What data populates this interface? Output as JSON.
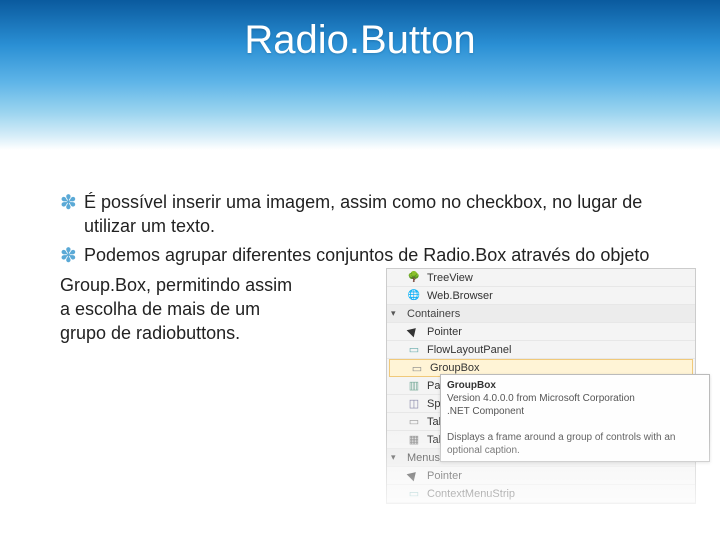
{
  "title": "Radio.Button",
  "bullets": [
    "É possível inserir uma imagem, assim como no checkbox, no lugar de utilizar um texto.",
    "Podemos agrupar diferentes conjuntos de Radio.Box através do objeto"
  ],
  "lines": [
    "Group.Box, permitindo assim",
    "a escolha de mais de um",
    "grupo de radiobuttons."
  ],
  "toolbox": {
    "row_treeview": "TreeView",
    "row_webbrowser": "Web.Browser",
    "group_containers": "Containers",
    "row_pointer": "Pointer",
    "row_flowlayout": "FlowLayoutPanel",
    "row_groupbox": "GroupBox",
    "row_panel": "Panel",
    "row_splitcontainer": "SplitContainer",
    "row_tabcontrol": "TabControl",
    "row_tablelayout": "TableLayoutPanel",
    "group_menus": "Menus & Toolbars",
    "row_pointer2": "Pointer",
    "row_contextmenu": "ContextMenuStrip"
  },
  "tooltip": {
    "title": "GroupBox",
    "line1": "Version 4.0.0.0 from Microsoft Corporation",
    "line2": ".NET Component",
    "line3": "Displays a frame around a group of controls with an optional caption."
  }
}
